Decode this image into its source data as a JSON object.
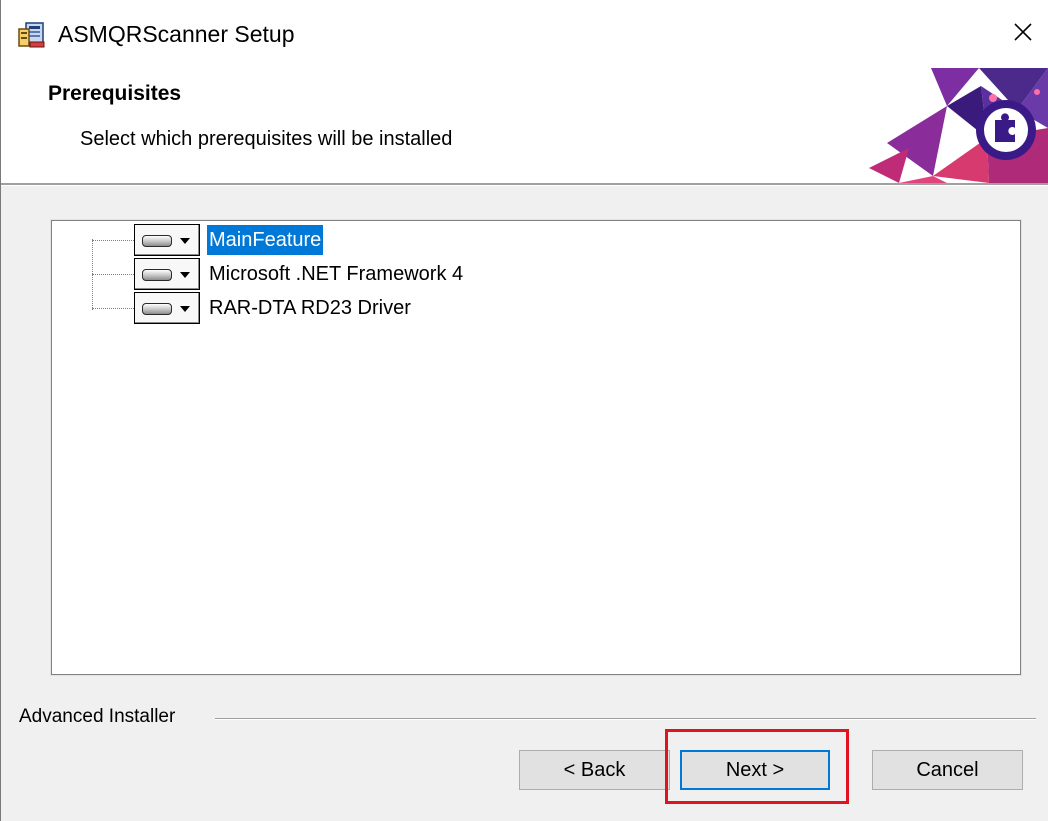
{
  "window": {
    "title": "ASMQRScanner Setup",
    "app_icon": "installer-icon",
    "close_icon": "close-icon"
  },
  "header": {
    "title": "Prerequisites",
    "subtitle": "Select which prerequisites will be installed",
    "logo_icon": "puzzle-logo-icon"
  },
  "tree": {
    "items": [
      {
        "label": "MainFeature",
        "selected": true,
        "icon": "hard-drive-icon"
      },
      {
        "label": "Microsoft .NET Framework 4",
        "selected": false,
        "icon": "hard-drive-icon"
      },
      {
        "label": "RAR-DTA RD23 Driver",
        "selected": false,
        "icon": "hard-drive-icon"
      }
    ]
  },
  "footer": {
    "brand": "Advanced Installer"
  },
  "buttons": {
    "back": "< Back",
    "next": "Next >",
    "cancel": "Cancel"
  },
  "colors": {
    "selection": "#0078d7",
    "highlight": "#e0141e",
    "window_bg": "#f0f0f0"
  }
}
